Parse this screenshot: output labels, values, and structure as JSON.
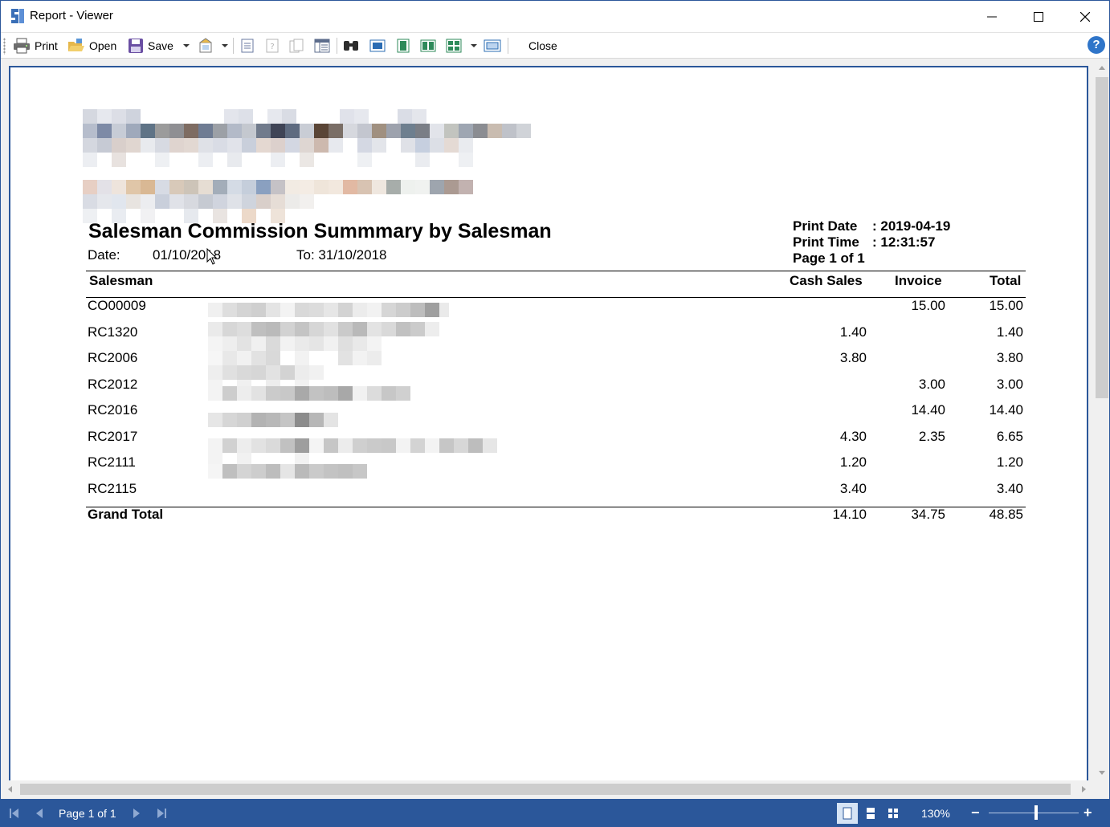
{
  "window": {
    "title": "Report - Viewer"
  },
  "toolbar": {
    "print_label": "Print",
    "open_label": "Open",
    "save_label": "Save",
    "close_label": "Close",
    "help_label": "?"
  },
  "report": {
    "title": "Salesman Commission Summmary by Salesman",
    "date_label": "Date:",
    "date_from": "01/10/2018",
    "date_to": "To: 31/10/2018",
    "print_date_label": "Print Date",
    "print_date_value": ": 2019-04-19",
    "print_time_label": "Print Time",
    "print_time_value": ": 12:31:57",
    "page_info": "Page 1 of 1",
    "columns": {
      "salesman": "Salesman",
      "cash_sales": "Cash Sales",
      "invoice": "Invoice",
      "total": "Total"
    },
    "rows": [
      {
        "code": "CO00009",
        "cash": "",
        "invoice": "15.00",
        "total": "15.00"
      },
      {
        "code": "RC1320",
        "cash": "1.40",
        "invoice": "",
        "total": "1.40"
      },
      {
        "code": "RC2006",
        "cash": "3.80",
        "invoice": "",
        "total": "3.80"
      },
      {
        "code": "RC2012",
        "cash": "",
        "invoice": "3.00",
        "total": "3.00"
      },
      {
        "code": "RC2016",
        "cash": "",
        "invoice": "14.40",
        "total": "14.40"
      },
      {
        "code": "RC2017",
        "cash": "4.30",
        "invoice": "2.35",
        "total": "6.65"
      },
      {
        "code": "RC2111",
        "cash": "1.20",
        "invoice": "",
        "total": "1.20"
      },
      {
        "code": "RC2115",
        "cash": "3.40",
        "invoice": "",
        "total": "3.40"
      }
    ],
    "grand_total": {
      "label": "Grand Total",
      "cash": "14.10",
      "invoice": "34.75",
      "total": "48.85"
    }
  },
  "statusbar": {
    "page_text": "Page 1 of 1",
    "zoom": "130%",
    "zoom_out": "−",
    "zoom_in": "+"
  },
  "colors": {
    "accent": "#2b579a",
    "help": "#2f75c9"
  }
}
